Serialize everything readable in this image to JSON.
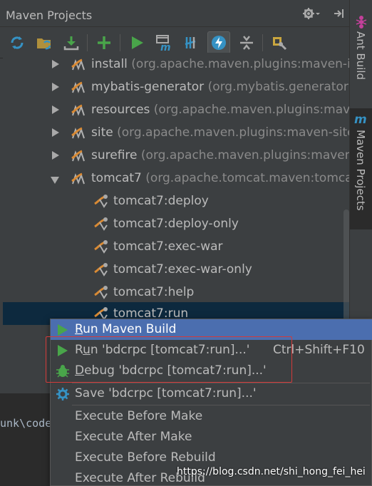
{
  "window": {
    "title": "Maven Projects",
    "gear_icon": "gear-icon",
    "hide_icon": "hide-panel-icon"
  },
  "toolbar": {
    "buttons": [
      {
        "name": "reimport-icon"
      },
      {
        "name": "generate-sources-icon"
      },
      {
        "name": "download-icon"
      },
      {
        "name": "add-icon"
      },
      {
        "name": "run-icon"
      },
      {
        "name": "execute-goal-icon"
      },
      {
        "name": "toggle-offline-icon"
      },
      {
        "name": "skip-tests-icon"
      },
      {
        "name": "collapse-all-icon"
      },
      {
        "name": "settings-icon"
      }
    ]
  },
  "side_tabs": {
    "ant_build": "Ant Build",
    "maven_projects": "Maven Projects"
  },
  "tree": {
    "plugins": [
      {
        "name": "install",
        "detail": "(org.apache.maven.plugins:maven-i"
      },
      {
        "name": "mybatis-generator",
        "detail": "(org.mybatis.generator"
      },
      {
        "name": "resources",
        "detail": "(org.apache.maven.plugins:mave"
      },
      {
        "name": "site",
        "detail": "(org.apache.maven.plugins:maven-site"
      },
      {
        "name": "surefire",
        "detail": "(org.apache.maven.plugins:maven"
      },
      {
        "name": "tomcat7",
        "detail": "(org.apache.tomcat.maven:tomca"
      }
    ],
    "goals": [
      "tomcat7:deploy",
      "tomcat7:deploy-only",
      "tomcat7:exec-war",
      "tomcat7:exec-war-only",
      "tomcat7:help",
      "tomcat7:run"
    ]
  },
  "editor": {
    "text": "unk\\code"
  },
  "context_menu": {
    "items": [
      {
        "mnemonic": "R",
        "rest": "un Maven Build",
        "shortcut": ""
      },
      {
        "mnemonic": "R",
        "rest": "un 'bdcrpc [tomcat7:run]...'",
        "shortcut": "Ctrl+Shift+F10",
        "mnemonic_prefix": "R",
        "label_full": "Run 'bdcrpc [tomcat7:run]...'"
      },
      {
        "mnemonic": "D",
        "rest": "ebug 'bdcrpc [tomcat7:run]...'",
        "shortcut": ""
      },
      {
        "label": "Save 'bdcrpc [tomcat7:run]...'"
      },
      {
        "label": "Execute Before Make"
      },
      {
        "label": "Execute After Make"
      },
      {
        "label": "Execute Before Rebuild"
      },
      {
        "label": "Execute After Rebuild"
      }
    ]
  },
  "watermark": "https://blog.csdn.net/shi_hong_fei_hei",
  "colors": {
    "background": "#3c3f41",
    "selection": "#0d293e",
    "menu_highlight": "#4b6eaf",
    "run_green": "#49a54a",
    "annotation_red": "#d33a3a"
  }
}
